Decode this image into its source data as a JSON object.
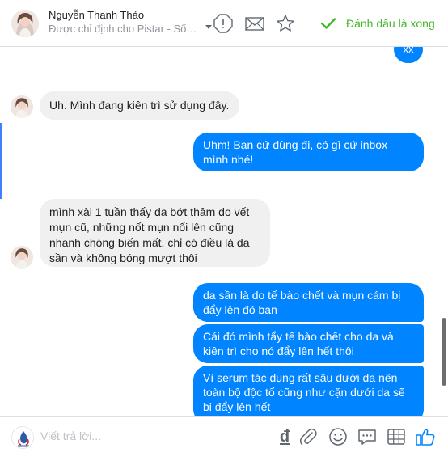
{
  "header": {
    "contact_name": "Nguyễn Thanh Thảo",
    "assigned_to": "Được chỉ định cho Pistar - Sống ...",
    "mark_done_label": "Đánh dấu là xong"
  },
  "messages": [
    {
      "dir": "out",
      "text": "xx"
    },
    {
      "dir": "in",
      "text": "Uh. Mình đang kiên trì sử dụng đây."
    },
    {
      "dir": "out",
      "lines": [
        "Uhm! Bạn cứ dùng đi, có gì cứ inbox",
        "mình nhé!"
      ]
    },
    {
      "dir": "in",
      "lines": [
        "mình xài 1 tuần thấy da bớt thâm do vết",
        "mụn cũ, những nốt mụn nổi lên cũng",
        "nhanh chóng biến mất, chỉ có điều là da",
        "sần và không bóng mượt thôi"
      ]
    },
    {
      "dir": "out",
      "lines": [
        "da sần là do tế bào chết và mụn cám bị",
        "đẩy lên đó bạn"
      ]
    },
    {
      "dir": "out",
      "lines": [
        "Cái đó mình tẩy tế bào chết cho da và",
        "kiên trì cho nó đẩy lên hết thôi"
      ]
    },
    {
      "dir": "out",
      "lines": [
        "Vì serum tác dụng rất sâu dưới da nên",
        "toàn bộ độc tố cũng như cặn dưới da sẽ",
        "bị đẩy lên hết"
      ]
    }
  ],
  "composer": {
    "placeholder": "Viết trả lời...",
    "currency_symbol": "đ"
  },
  "colors": {
    "outgoing_bubble": "#0084ff",
    "incoming_bubble": "#f1f0f0",
    "mark_done": "#42b72a",
    "like": "#0084ff"
  },
  "icons": [
    "alert-icon",
    "envelope-icon",
    "star-icon",
    "check-icon",
    "attachment-icon",
    "smiley-icon",
    "speech-bubble-icon",
    "grid-icon",
    "thumbs-up-icon"
  ]
}
